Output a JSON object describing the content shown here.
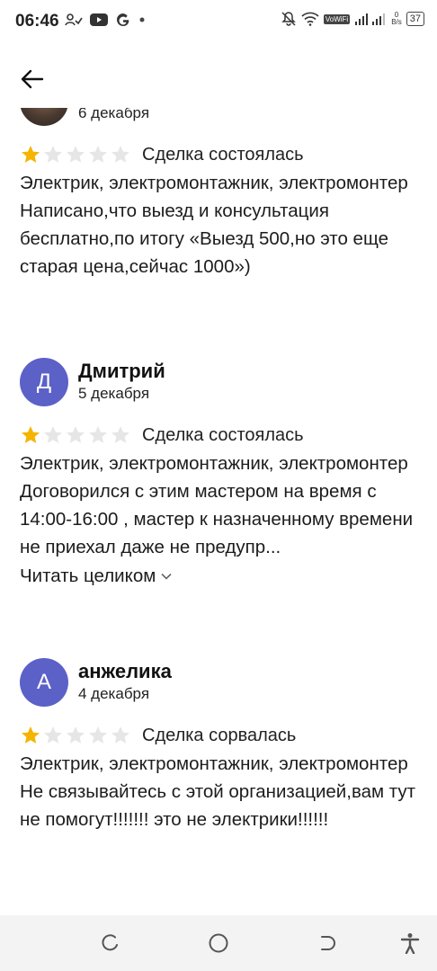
{
  "status_bar": {
    "time": "06:46",
    "battery": "37",
    "net_speed_top": "0",
    "net_speed_bottom": "B/s",
    "wifi_label": "VoWiFi"
  },
  "app_bar": {
    "back_icon": "arrow-left-icon"
  },
  "colors": {
    "avatar": "#5b61c7",
    "star_filled": "#f5b400",
    "star_empty": "#e6e6e6"
  },
  "reviews": [
    {
      "name": "",
      "date": "6 декабря",
      "rating": 1,
      "deal_status": "Сделка состоялась",
      "category": "Электрик, электромонтажник, электромонтер",
      "text": "Написано,что выезд и консультация бесплатно,по итогу «Выезд 500,но это еще старая цена,сейчас 1000»)"
    },
    {
      "name": "Дмитрий",
      "avatar_letter": "Д",
      "date": "5 декабря",
      "rating": 1,
      "deal_status": "Сделка состоялась",
      "category": "Электрик, электромонтажник, электромонтер",
      "text": "Договорился с этим мастером на время с 14:00-16:00 , мастер к назначенному времени не приехал даже не предупр...",
      "read_more": "Читать целиком"
    },
    {
      "name": "анжелика",
      "avatar_letter": "А",
      "date": "4 декабря",
      "rating": 1,
      "deal_status": "Сделка сорвалась",
      "category": "Электрик, электромонтажник, электромонтер",
      "text": "Не связывайтесь с этой организацией,вам тут не помогут!!!!!!! это не электрики!!!!!!"
    }
  ],
  "nav_bar": {
    "buttons": [
      "recents-icon",
      "home-icon",
      "back-nav-icon",
      "accessibility-icon"
    ]
  }
}
